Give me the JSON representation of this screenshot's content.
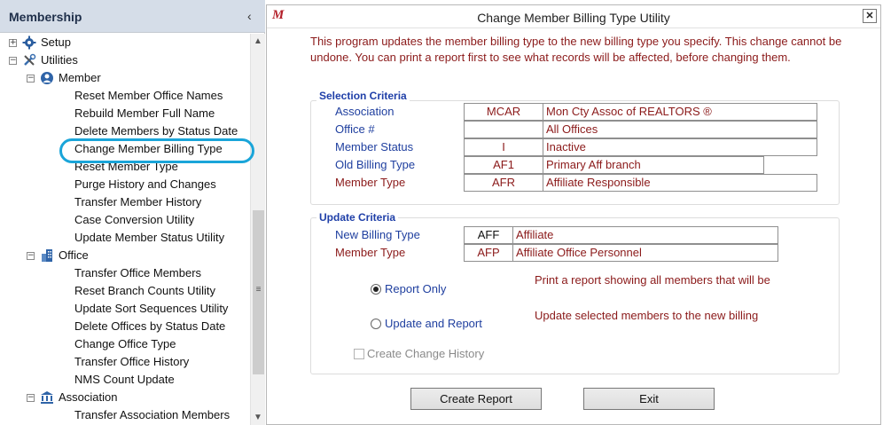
{
  "sidebar": {
    "title": "Membership",
    "collapse_glyph": "‹",
    "tree": [
      {
        "label": "Setup",
        "level": 0,
        "expander": "+",
        "icon": "gear-icon"
      },
      {
        "label": "Utilities",
        "level": 0,
        "expander": "−",
        "icon": "tools-icon"
      },
      {
        "label": "Member",
        "level": 1,
        "expander": "−",
        "icon": "user-circle-icon"
      },
      {
        "label": "Reset Member Office Names",
        "level": 2
      },
      {
        "label": "Rebuild Member Full Name",
        "level": 2
      },
      {
        "label": "Delete Members by Status Date",
        "level": 2
      },
      {
        "label": "Change Member Billing Type",
        "level": 2,
        "highlighted": true
      },
      {
        "label": "Reset Member Type",
        "level": 2
      },
      {
        "label": "Purge History and Changes",
        "level": 2
      },
      {
        "label": "Transfer Member History",
        "level": 2
      },
      {
        "label": "Case Conversion Utility",
        "level": 2
      },
      {
        "label": "Update Member Status Utility",
        "level": 2
      },
      {
        "label": "Office",
        "level": 1,
        "expander": "−",
        "icon": "building-icon"
      },
      {
        "label": "Transfer Office Members",
        "level": 2
      },
      {
        "label": "Reset Branch Counts Utility",
        "level": 2
      },
      {
        "label": "Update Sort Sequences Utility",
        "level": 2
      },
      {
        "label": "Delete Offices by Status Date",
        "level": 2
      },
      {
        "label": "Change Office Type",
        "level": 2
      },
      {
        "label": "Transfer Office History",
        "level": 2
      },
      {
        "label": "NMS Count Update",
        "level": 2
      },
      {
        "label": "Association",
        "level": 1,
        "expander": "−",
        "icon": "bank-icon"
      },
      {
        "label": "Transfer Association Members",
        "level": 2
      }
    ],
    "scroll_up": "▲",
    "scroll_down": "▼",
    "scroll_grip": "≡"
  },
  "dialog": {
    "app_logo": "M",
    "title": "Change Member Billing Type Utility",
    "close_glyph": "✕",
    "description": "This program updates the member billing type to the new billing type you specify. This change cannot be undone. You can print a report first to see what records will be affected, before changing them.",
    "selection": {
      "legend": "Selection Criteria",
      "rows": [
        {
          "label": "Association",
          "code": "MCAR",
          "value": "Mon Cty Assoc of REALTORS ®"
        },
        {
          "label": "Office #",
          "code": "",
          "value": "All Offices"
        },
        {
          "label": "Member Status",
          "code": "I",
          "value": "Inactive"
        },
        {
          "label": "Old Billing Type",
          "code": "AF1",
          "value": "Primary Aff branch"
        },
        {
          "label": "Member Type",
          "code": "AFR",
          "value": "Affiliate Responsible"
        }
      ]
    },
    "update": {
      "legend": "Update Criteria",
      "rows": [
        {
          "label": "New Billing Type",
          "code": "AFF",
          "value": "Affiliate"
        },
        {
          "label": "Member Type",
          "code": "AFP",
          "value": "Affiliate Office Personnel"
        }
      ],
      "options": [
        {
          "label": "Report Only",
          "selected": true,
          "description": "Print a report showing all members that will be"
        },
        {
          "label": "Update and Report",
          "selected": false,
          "description": "Update selected members to the new billing"
        }
      ],
      "change_history_label": "Create Change History",
      "change_history_checked": false
    },
    "buttons": {
      "create_report": "Create Report",
      "exit": "Exit"
    }
  },
  "colors": {
    "accent_blue": "#1f3fa8",
    "text_red": "#8b1a1a",
    "highlight": "#1aa5d9",
    "sidebar_header": "#d5dde8"
  }
}
